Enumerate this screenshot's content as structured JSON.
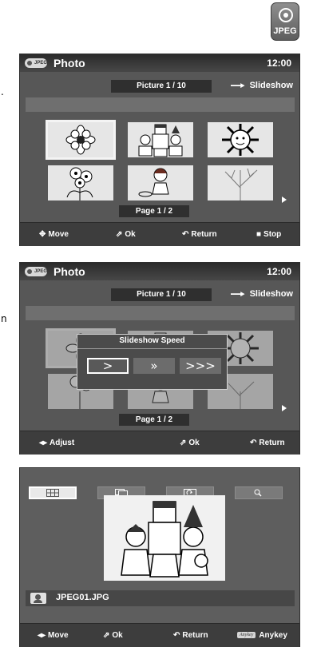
{
  "badge": {
    "label": "JPEG"
  },
  "side_marks": [
    ".",
    "n"
  ],
  "screens": [
    {
      "title": "Photo",
      "clock": "12:00",
      "picture_counter": "Picture 1 / 10",
      "slideshow_label": "Slideshow",
      "page_indicator": "Page 1 / 2",
      "footer": {
        "move": "Move",
        "ok": "Ok",
        "return": "Return",
        "stop": "Stop"
      }
    },
    {
      "title": "Photo",
      "clock": "12:00",
      "picture_counter": "Picture 1 / 10",
      "slideshow_label": "Slideshow",
      "page_indicator": "Page 1 / 2",
      "dialog": {
        "title": "Slideshow Speed",
        "options": [
          ">",
          "»",
          ">>>"
        ],
        "selected_index": 0
      },
      "footer": {
        "adjust": "Adjust",
        "ok": "Ok",
        "return": "Return"
      }
    },
    {
      "toolbar": [
        "grid-view-icon",
        "slideshow-icon",
        "rotate-icon",
        "zoom-icon"
      ],
      "toolbar_selected_index": 0,
      "filename": "JPEG01.JPG",
      "footer": {
        "move": "Move",
        "ok": "Ok",
        "return": "Return",
        "anykey_badge": "Anykey",
        "anykey": "Anykey"
      }
    }
  ],
  "glyphs": {
    "move": "✥",
    "adjust": "◂▸",
    "ok": "⇗",
    "return": "↶",
    "stop": "■"
  }
}
